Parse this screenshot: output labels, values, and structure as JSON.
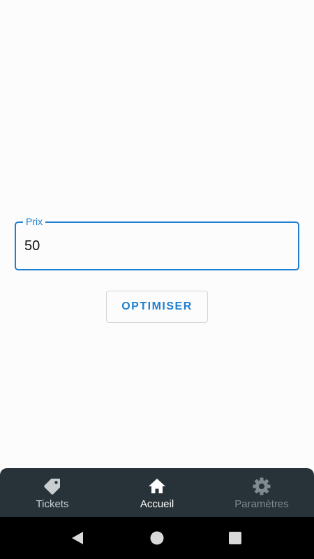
{
  "form": {
    "price_label": "Prix",
    "price_value": "50"
  },
  "actions": {
    "optimize_label": "OPTIMISER"
  },
  "bottom_nav": {
    "items": [
      {
        "label": "Tickets",
        "icon": "tag-icon",
        "active": false
      },
      {
        "label": "Accueil",
        "icon": "home-icon",
        "active": true
      },
      {
        "label": "Paramètres",
        "icon": "gear-icon",
        "active": false
      }
    ]
  },
  "system_nav": {
    "icons": [
      "back-icon",
      "home-circle-icon",
      "recent-apps-icon"
    ]
  },
  "colors": {
    "accent": "#1f7fd0",
    "nav_background": "#273339",
    "background": "#fcfcfc"
  }
}
